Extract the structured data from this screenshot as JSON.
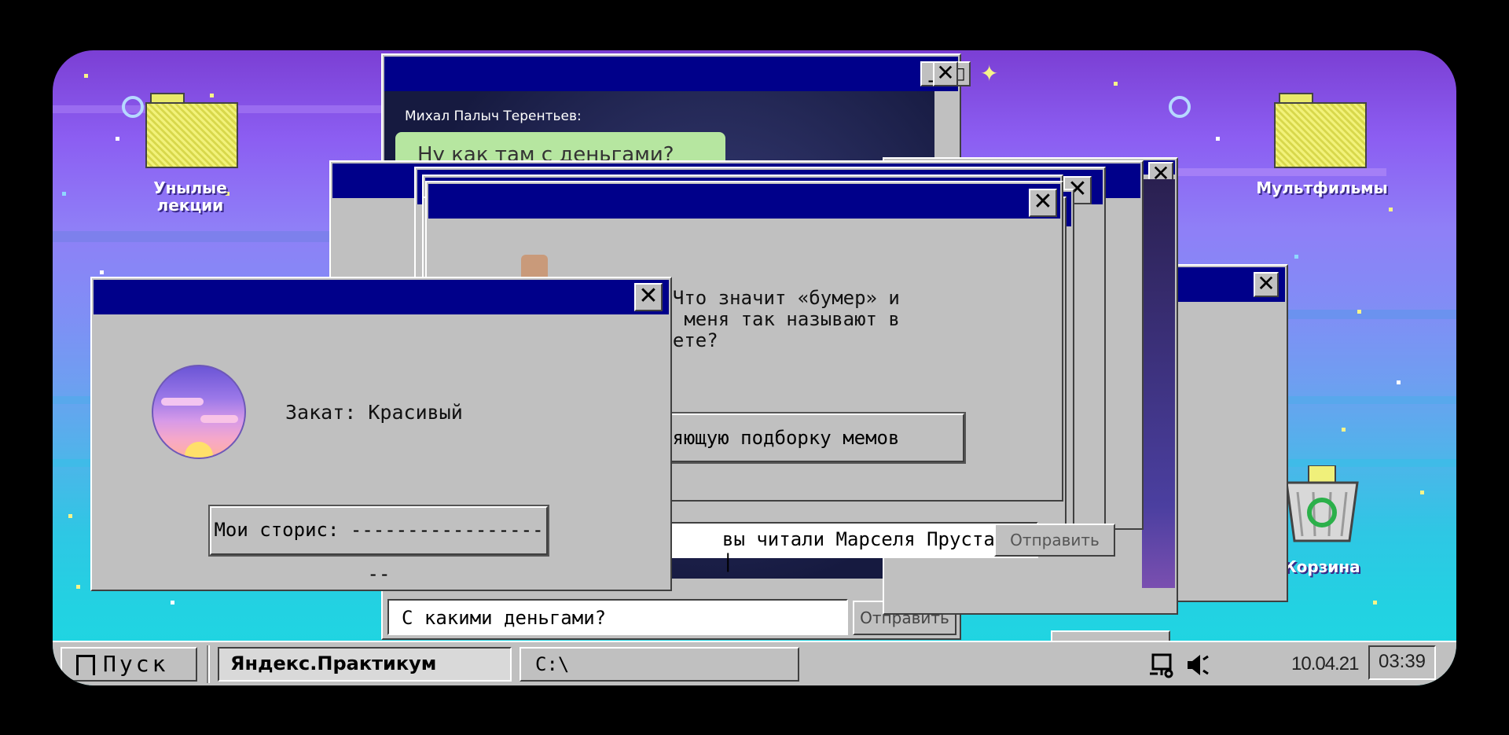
{
  "desktop": {
    "icons": {
      "folder_left": "Унылые лекции",
      "folder_right": "Мультфильмы",
      "trash": "Корзина"
    }
  },
  "chat_window": {
    "sender": "Михал Палыч Терентьев:",
    "message_partial": "Ну как там с деньгами?",
    "input_value": "С какими деньгами?",
    "send_label": "Отправить"
  },
  "proust_window": {
    "input_value": "вы читали Марселя Пруста? |",
    "send_label": "Отправить"
  },
  "boomer_window": {
    "message": "Что значит «бумер» и почему меня так называют в интернете?",
    "line1": ": Что значит «бумер» и",
    "line2": "му меня так называют в",
    "line3": "рнете?",
    "button_partial": "няющую подборку мемов"
  },
  "sunset_window": {
    "label": "Закат: Красивый",
    "stories_button": "Мои сторис: -------------------"
  },
  "taskbar": {
    "start_label": "Пуск",
    "task1": "Яндекс.Практикум",
    "task2": "C:\\",
    "date": "10.04.21",
    "time": "03:39"
  },
  "icons": [
    "folder-icon",
    "trash-icon",
    "network-icon",
    "speaker-icon",
    "close-icon",
    "minimize-icon",
    "maximize-icon",
    "start-icon"
  ]
}
